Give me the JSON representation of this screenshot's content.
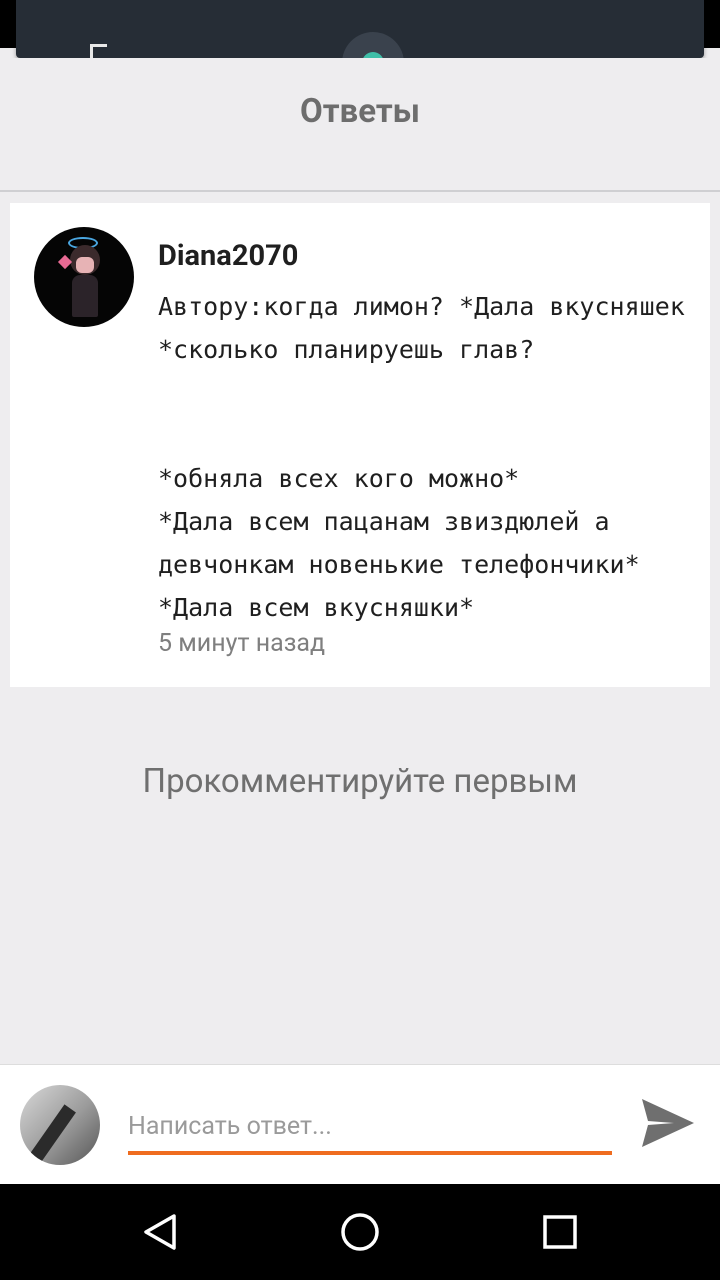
{
  "header": {
    "title": "Ответы"
  },
  "comment": {
    "author": "Diana2070",
    "text": "Автору:когда лимон? *Дала вкусняшек\n*сколько планируешь глав?\n\n\n*обняла всех кого можно*\n*Дала всем пацанам звиздюлей а\nдевчонкам новенькие телефончики*\n*Дала всем вкусняшки*",
    "timestamp": "5 минут назад"
  },
  "empty_state": {
    "text": "Прокомментируйте первым"
  },
  "reply_bar": {
    "placeholder": "Написать ответ...",
    "accent_color": "#ef6c1f"
  },
  "icons": {
    "send": "send-icon",
    "back": "back-icon",
    "home": "home-icon",
    "recents": "recents-icon"
  }
}
